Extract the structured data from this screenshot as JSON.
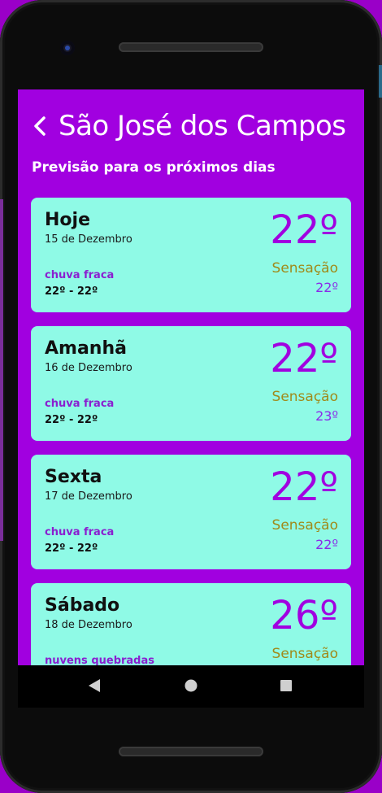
{
  "header": {
    "city": "São José dos Campos",
    "subtitle": "Previsão para os próximos dias"
  },
  "forecast": [
    {
      "day": "Hoje",
      "date": "15 de Dezembro",
      "description": "chuva fraca",
      "range": "22º - 22º",
      "temp": "22º",
      "feels_label": "Sensação",
      "feels": "22º"
    },
    {
      "day": "Amanhã",
      "date": "16 de Dezembro",
      "description": "chuva fraca",
      "range": "22º - 22º",
      "temp": "22º",
      "feels_label": "Sensação",
      "feels": "23º"
    },
    {
      "day": "Sexta",
      "date": "17 de Dezembro",
      "description": "chuva fraca",
      "range": "22º - 22º",
      "temp": "22º",
      "feels_label": "Sensação",
      "feels": "22º"
    },
    {
      "day": "Sábado",
      "date": "18 de Dezembro",
      "description": "nuvens quebradas",
      "temp": "26º",
      "feels_label": "Sensação"
    }
  ],
  "nav": {
    "icons": [
      "back-triangle-icon",
      "home-circle-icon",
      "recents-square-icon"
    ]
  },
  "colors": {
    "app_bg": "#a100e0",
    "card_bg": "#8ffae6",
    "accent": "#a100e0",
    "feels_label": "#a08a1a"
  }
}
